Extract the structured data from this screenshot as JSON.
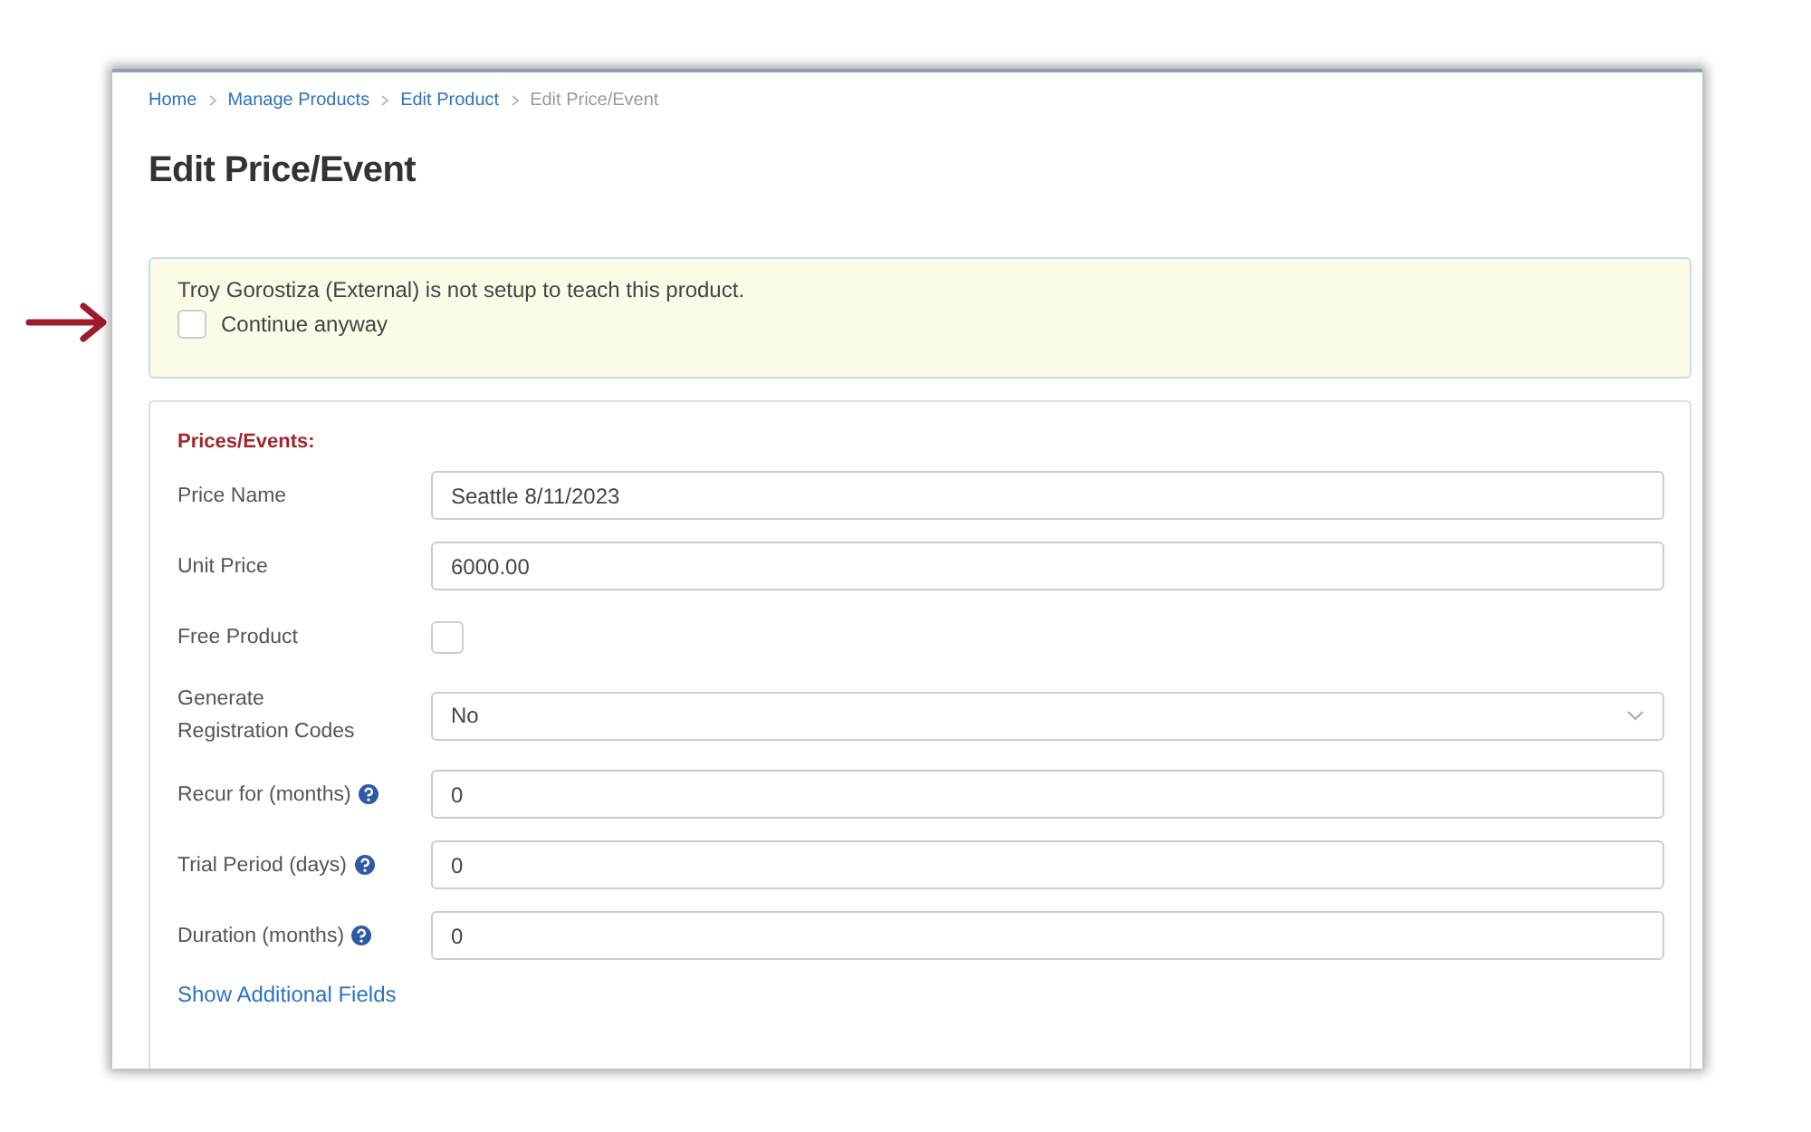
{
  "breadcrumb": [
    {
      "label": "Home",
      "current": false
    },
    {
      "label": "Manage Products",
      "current": false
    },
    {
      "label": "Edit Product",
      "current": false
    },
    {
      "label": "Edit Price/Event",
      "current": true
    }
  ],
  "title": "Edit Price/Event",
  "alert": {
    "message": "Troy Gorostiza (External) is not setup to teach this product.",
    "checkbox": {
      "label": "Continue anyway",
      "checked": false
    }
  },
  "section": {
    "heading": "Prices/Events:",
    "fields": [
      {
        "label": "Price Name",
        "kind": "text",
        "value": "Seattle 8/11/2023",
        "help": false
      },
      {
        "label": "Unit Price",
        "kind": "text",
        "value": "6000.00",
        "help": false
      },
      {
        "label": "Free Product",
        "kind": "checkbox",
        "checked": false,
        "help": false
      },
      {
        "label": "Generate Registration Codes",
        "kind": "select",
        "value": "No",
        "help": false
      },
      {
        "label": "Recur for (months)",
        "kind": "text",
        "value": "0",
        "help": true
      },
      {
        "label": "Trial Period (days)",
        "kind": "text",
        "value": "0",
        "help": true
      },
      {
        "label": "Duration (months)",
        "kind": "text",
        "value": "0",
        "help": true
      }
    ],
    "link": "Show Additional Fields"
  }
}
